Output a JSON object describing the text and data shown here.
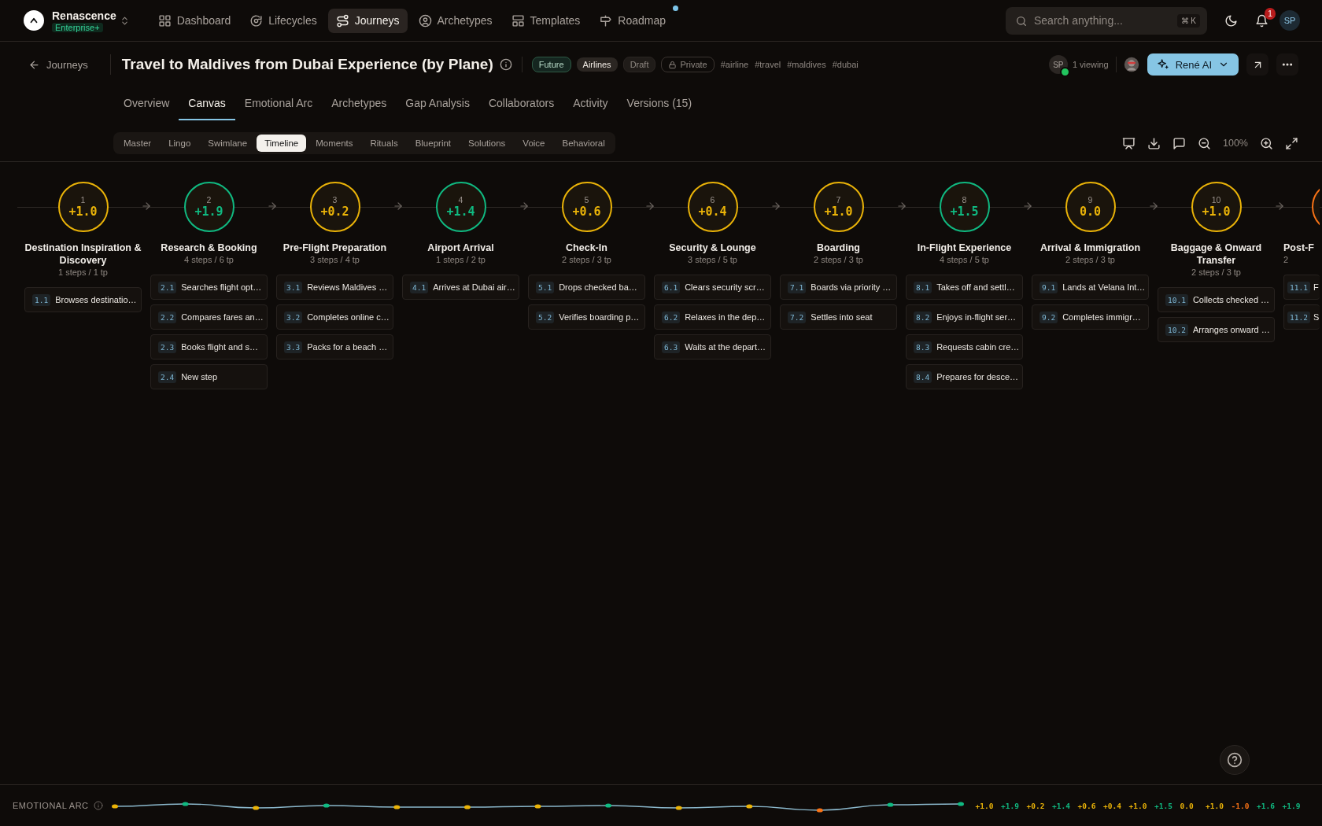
{
  "brand": {
    "name": "Renascence",
    "plan": "Enterprise+"
  },
  "nav": [
    {
      "label": "Dashboard",
      "selected": false,
      "dot": false
    },
    {
      "label": "Lifecycles",
      "selected": false,
      "dot": false
    },
    {
      "label": "Journeys",
      "selected": true,
      "dot": false
    },
    {
      "label": "Archetypes",
      "selected": false,
      "dot": false
    },
    {
      "label": "Templates",
      "selected": false,
      "dot": false
    },
    {
      "label": "Roadmap",
      "selected": false,
      "dot": true
    }
  ],
  "search": {
    "placeholder": "Search anything...",
    "shortcut": "⌘ K"
  },
  "notifications": {
    "count": "1"
  },
  "user": {
    "initials": "SP"
  },
  "header": {
    "back": "Journeys",
    "title": "Travel to Maldives from Dubai Experience (by Plane)",
    "tags": [
      {
        "label": "Future",
        "kind": "stage"
      },
      {
        "label": "Airlines",
        "kind": "industry"
      },
      {
        "label": "Draft",
        "kind": "status"
      },
      {
        "label": "Private",
        "kind": "privacy"
      }
    ],
    "hashtags": [
      "#airline",
      "#travel",
      "#maldives",
      "#dubai"
    ],
    "viewer": {
      "initials": "SP",
      "online": true
    },
    "viewing": "1 viewing",
    "ai_button": "René AI"
  },
  "tabs": [
    {
      "label": "Overview",
      "selected": false
    },
    {
      "label": "Canvas",
      "selected": true
    },
    {
      "label": "Emotional Arc",
      "selected": false
    },
    {
      "label": "Archetypes",
      "selected": false
    },
    {
      "label": "Gap Analysis",
      "selected": false
    },
    {
      "label": "Collaborators",
      "selected": false
    },
    {
      "label": "Activity",
      "selected": false
    },
    {
      "label": "Versions (15)",
      "selected": false
    }
  ],
  "views": [
    {
      "label": "Master",
      "selected": false
    },
    {
      "label": "Lingo",
      "selected": false
    },
    {
      "label": "Swimlane",
      "selected": false
    },
    {
      "label": "Timeline",
      "selected": true
    },
    {
      "label": "Moments",
      "selected": false
    },
    {
      "label": "Rituals",
      "selected": false
    },
    {
      "label": "Blueprint",
      "selected": false
    },
    {
      "label": "Solutions",
      "selected": false
    },
    {
      "label": "Voice",
      "selected": false
    },
    {
      "label": "Behavioral",
      "selected": false
    }
  ],
  "zoom": "100%",
  "timeline": {
    "stages": [
      {
        "number": "1",
        "score": "+1.0",
        "color": "#eab308",
        "name": "Destination Inspiration & Discovery",
        "meta": "1 steps / 1 tp",
        "steps": [
          {
            "num": "1.1",
            "text": "Browses destinatio…"
          }
        ]
      },
      {
        "number": "2",
        "score": "+1.9",
        "color": "#10b981",
        "name": "Research & Booking",
        "meta": "4 steps / 6 tp",
        "steps": [
          {
            "num": "2.1",
            "text": "Searches flight opt…"
          },
          {
            "num": "2.2",
            "text": "Compares fares an…"
          },
          {
            "num": "2.3",
            "text": "Books flight and s…"
          },
          {
            "num": "2.4",
            "text": "New step"
          }
        ]
      },
      {
        "number": "3",
        "score": "+0.2",
        "color": "#eab308",
        "name": "Pre-Flight Preparation",
        "meta": "3 steps / 4 tp",
        "steps": [
          {
            "num": "3.1",
            "text": "Reviews Maldives …"
          },
          {
            "num": "3.2",
            "text": "Completes online c…"
          },
          {
            "num": "3.3",
            "text": "Packs for a beach …"
          }
        ]
      },
      {
        "number": "4",
        "score": "+1.4",
        "color": "#10b981",
        "name": "Airport Arrival",
        "meta": "1 steps / 2 tp",
        "steps": [
          {
            "num": "4.1",
            "text": "Arrives at Dubai air…"
          }
        ]
      },
      {
        "number": "5",
        "score": "+0.6",
        "color": "#eab308",
        "name": "Check-In",
        "meta": "2 steps / 3 tp",
        "steps": [
          {
            "num": "5.1",
            "text": "Drops checked ba…"
          },
          {
            "num": "5.2",
            "text": "Verifies boarding p…"
          }
        ]
      },
      {
        "number": "6",
        "score": "+0.4",
        "color": "#eab308",
        "name": "Security & Lounge",
        "meta": "3 steps / 5 tp",
        "steps": [
          {
            "num": "6.1",
            "text": "Clears security scr…"
          },
          {
            "num": "6.2",
            "text": "Relaxes in the dep…"
          },
          {
            "num": "6.3",
            "text": "Waits at the depart…"
          }
        ]
      },
      {
        "number": "7",
        "score": "+1.0",
        "color": "#eab308",
        "name": "Boarding",
        "meta": "2 steps / 3 tp",
        "steps": [
          {
            "num": "7.1",
            "text": "Boards via priority …"
          },
          {
            "num": "7.2",
            "text": "Settles into seat"
          }
        ]
      },
      {
        "number": "8",
        "score": "+1.5",
        "color": "#10b981",
        "name": "In-Flight Experience",
        "meta": "4 steps / 5 tp",
        "steps": [
          {
            "num": "8.1",
            "text": "Takes off and settl…"
          },
          {
            "num": "8.2",
            "text": "Enjoys in-flight ser…"
          },
          {
            "num": "8.3",
            "text": "Requests cabin cre…"
          },
          {
            "num": "8.4",
            "text": "Prepares for desce…"
          }
        ]
      },
      {
        "number": "9",
        "score": "0.0",
        "color": "#eab308",
        "name": "Arrival & Immigration",
        "meta": "2 steps / 3 tp",
        "steps": [
          {
            "num": "9.1",
            "text": "Lands at Velana Int…"
          },
          {
            "num": "9.2",
            "text": "Completes immigr…"
          }
        ]
      },
      {
        "number": "10",
        "score": "+1.0",
        "color": "#eab308",
        "name": "Baggage & Onward Transfer",
        "meta": "2 steps / 3 tp",
        "steps": [
          {
            "num": "10.1",
            "text": "Collects checked …"
          },
          {
            "num": "10.2",
            "text": "Arranges onward …"
          }
        ]
      },
      {
        "kind": "cut",
        "color": "#f97316",
        "name": "Post-F",
        "meta": "2",
        "steps": [
          {
            "num": "11.1",
            "text": "F"
          },
          {
            "num": "11.2",
            "text": "S"
          }
        ]
      }
    ]
  },
  "emotional_arc": {
    "label": "EMOTIONAL ARC",
    "values": [
      {
        "text": "+1.0",
        "color": "#eab308"
      },
      {
        "text": "+1.9",
        "color": "#10b981"
      },
      {
        "text": "+0.2",
        "color": "#eab308"
      },
      {
        "text": "+1.4",
        "color": "#10b981"
      },
      {
        "text": "+0.6",
        "color": "#eab308"
      },
      {
        "text": "+0.4",
        "color": "#eab308"
      },
      {
        "text": "+1.0",
        "color": "#eab308"
      },
      {
        "text": "+1.5",
        "color": "#10b981"
      },
      {
        "text": "0.0",
        "color": "#eab308"
      },
      {
        "text": "+1.0",
        "color": "#eab308"
      },
      {
        "text": "-1.0",
        "color": "#f97316"
      },
      {
        "text": "+1.6",
        "color": "#10b981"
      },
      {
        "text": "+1.9",
        "color": "#10b981"
      }
    ]
  }
}
